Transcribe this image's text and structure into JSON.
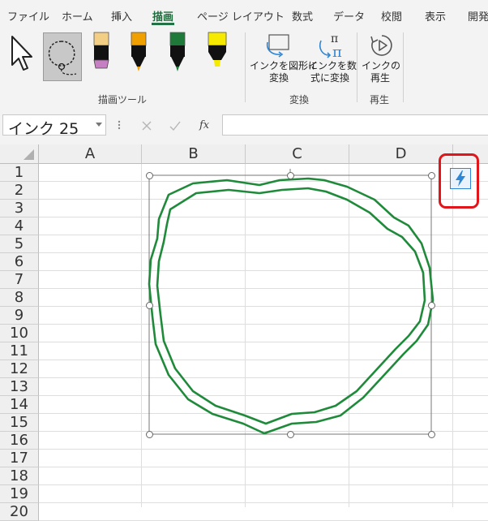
{
  "tabs": [
    "ファイル",
    "ホーム",
    "挿入",
    "描画",
    "ページ レイアウト",
    "数式",
    "データ",
    "校閲",
    "表示",
    "開発"
  ],
  "active_tab_index": 3,
  "ribbon": {
    "groups": {
      "draw_tools": "描画ツール",
      "convert": "変換",
      "replay": "再生"
    },
    "convert_ink_to_shape": [
      "インクを図形に",
      "変換"
    ],
    "ink_to_math": [
      "インクを数",
      "式に変換"
    ],
    "ink_replay": [
      "インクの",
      "再生"
    ],
    "pens": [
      {
        "color": "#c77fc4",
        "name": "pen-pink-icon"
      },
      {
        "color": "#f0a000",
        "name": "pen-orange-icon"
      },
      {
        "color": "#1f7a3a",
        "name": "pen-green-icon"
      },
      {
        "color": "#f5ea00",
        "name": "highlighter-yellow-icon"
      }
    ]
  },
  "formula_bar": {
    "name_box": "インク 25",
    "fx": "fx",
    "value": ""
  },
  "columns": [
    "A",
    "B",
    "C",
    "D"
  ],
  "rows": [
    "1",
    "2",
    "3",
    "4",
    "5",
    "6",
    "7",
    "8",
    "9",
    "10",
    "11",
    "12",
    "13",
    "14",
    "15",
    "16",
    "17",
    "18",
    "19",
    "20"
  ],
  "colors": {
    "accent": "#217346",
    "ink": "#1f8a3a",
    "highlight_box": "#e0161a",
    "lightning": "#2e86d6"
  }
}
